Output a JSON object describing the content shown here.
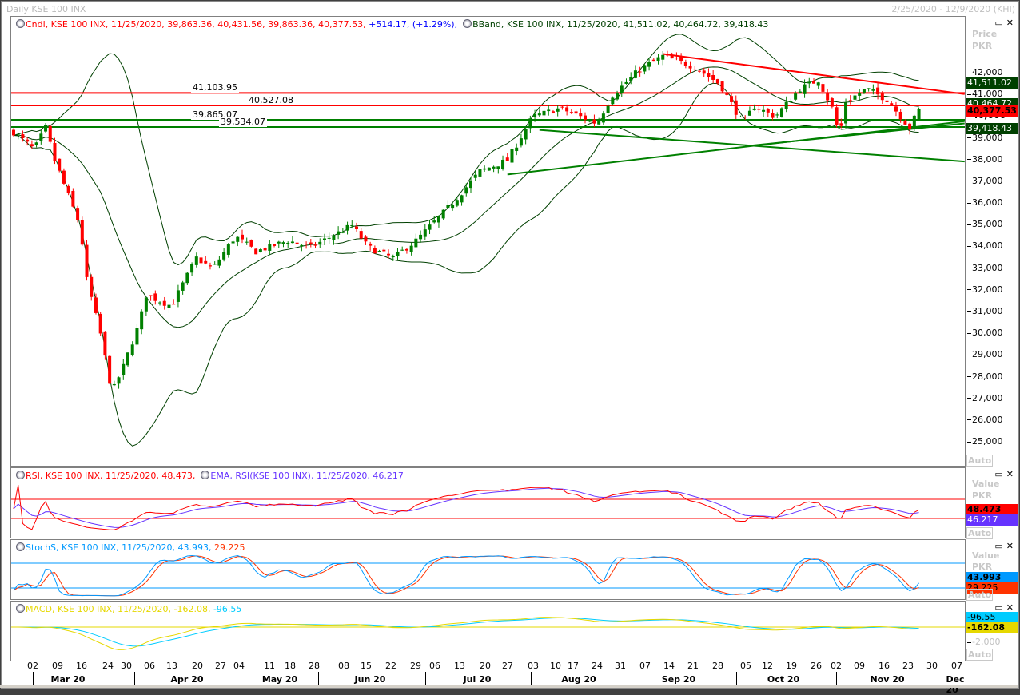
{
  "window": {
    "title": "Daily KSE 100 INX",
    "range": "2/25/2020 - 12/9/2020 (KHI)"
  },
  "price_panel": {
    "header_cndl": "Cndl, KSE 100 INX, 11/25/2020, 39,863.36, 40,431.56, 39,863.36, 40,377.53,",
    "header_change": "+514.17, (+1.29%),",
    "header_bband": "BBand, KSE 100 INX, 11/25/2020, 41,511.02, 40,464.72, 39,418.43",
    "axis_title": "Price",
    "axis_unit": "PKR",
    "auto": "Auto",
    "badges": {
      "bb_upper": "41,511.02",
      "bb_mid": "40,464.72",
      "close": "40,377.53",
      "bb_lower": "39,418.43"
    },
    "hlines": [
      {
        "label": "41,103.95",
        "value": 41103.95,
        "color": "#ff0000"
      },
      {
        "label": "40,527.08",
        "value": 40527.08,
        "color": "#ff0000"
      },
      {
        "label": "39,865.07",
        "value": 39865.07,
        "color": "#008000"
      },
      {
        "label": "39,534.07",
        "value": 39534.07,
        "color": "#008000"
      }
    ],
    "ticks": [
      "42,000",
      "41,000",
      "40,000",
      "39,000",
      "38,000",
      "37,000",
      "36,000",
      "35,000",
      "34,000",
      "33,000",
      "32,000",
      "31,000",
      "30,000",
      "29,000",
      "28,000",
      "27,000",
      "26,000",
      "25,000"
    ]
  },
  "rsi_panel": {
    "header_rsi": "RSI, KSE 100 INX, 11/25/2020, 48.473,",
    "header_ema": "EMA, RSI(KSE 100 INX), 11/25/2020, 46.217",
    "axis_title": "Value",
    "axis_unit": "PKR",
    "rsi_badge": "48.473",
    "ema_badge": "46.217",
    "auto": "Auto"
  },
  "stoch_panel": {
    "header_k": "StochS, KSE 100 INX, 11/25/2020, 43.993,",
    "header_d": "29.225",
    "axis_title": "Value",
    "axis_unit": "PKR",
    "k_badge": "43.993",
    "d_badge": "29.225",
    "auto": "Auto"
  },
  "macd_panel": {
    "header_macd": "MACD, KSE 100 INX, 11/25/2020, -162.08,",
    "header_signal": "-96.55",
    "signal_badge": "-96.55",
    "macd_badge": "-162.08",
    "tick": "-2,000",
    "auto": "Auto"
  },
  "x_axis": {
    "days": [
      "02",
      "09",
      "16",
      "24",
      "30",
      "06",
      "13",
      "20",
      "27",
      "04",
      "11",
      "18",
      "28",
      "08",
      "15",
      "22",
      "29",
      "06",
      "13",
      "20",
      "27",
      "03",
      "10",
      "17",
      "24",
      "31",
      "07",
      "14",
      "21",
      "28",
      "05",
      "12",
      "19",
      "26",
      "02",
      "09",
      "16",
      "23",
      "30",
      "07"
    ],
    "months": [
      "Mar 20",
      "Apr 20",
      "May 20",
      "Jun 20",
      "Jul 20",
      "Aug 20",
      "Sep 20",
      "Oct 20",
      "Nov 20",
      "Dec 20"
    ]
  },
  "colors": {
    "up": "#008000",
    "down": "#ff0000",
    "bband": "#004000",
    "rsi": "#ff0000",
    "ema": "#6633ff",
    "stoch_k": "#0099ff",
    "stoch_d": "#ff3300",
    "macd": "#e6d800",
    "signal": "#00ccff"
  },
  "chart_data": {
    "type": "candlestick",
    "title": "Daily KSE 100 INX",
    "ylabel": "Price PKR",
    "ylim": [
      24500,
      43500
    ],
    "last_bar": {
      "date": "11/25/2020",
      "open": 39863.36,
      "high": 40431.56,
      "low": 39863.36,
      "close": 40377.53
    },
    "close_keypoints_bar_price": [
      [
        0,
        39300
      ],
      [
        4.5,
        38500
      ],
      [
        7,
        39500
      ],
      [
        9,
        38000
      ],
      [
        14.5,
        35000
      ],
      [
        16,
        32500
      ],
      [
        19,
        30000
      ],
      [
        21.5,
        27300
      ],
      [
        24,
        28500
      ],
      [
        27.5,
        30500
      ],
      [
        29,
        31800
      ],
      [
        34.5,
        31300
      ],
      [
        40,
        33500
      ],
      [
        43.5,
        33000
      ],
      [
        48.5,
        34500
      ],
      [
        53,
        33800
      ],
      [
        60,
        34300
      ],
      [
        65,
        34000
      ],
      [
        74,
        35000
      ],
      [
        77.5,
        34000
      ],
      [
        83,
        33500
      ],
      [
        88,
        34300
      ],
      [
        95,
        35800
      ],
      [
        102,
        37500
      ],
      [
        108,
        38000
      ],
      [
        113.5,
        40000
      ],
      [
        119.5,
        40400
      ],
      [
        127.5,
        39700
      ],
      [
        131,
        41000
      ],
      [
        137,
        42200
      ],
      [
        142,
        42800
      ],
      [
        149,
        42300
      ],
      [
        154.5,
        41500
      ],
      [
        159.5,
        39700
      ],
      [
        162,
        40500
      ],
      [
        166.5,
        40000
      ],
      [
        172,
        41300
      ],
      [
        176,
        41700
      ],
      [
        179.5,
        40200
      ],
      [
        180.5,
        39000
      ],
      [
        182,
        40700
      ],
      [
        186.5,
        41300
      ],
      [
        191,
        40800
      ],
      [
        196,
        39500
      ],
      [
        198,
        40377.53
      ]
    ],
    "trendlines": [
      {
        "color": "#ff0000",
        "from": [
          142,
          42900
        ],
        "to": [
          208,
          41050
        ]
      },
      {
        "color": "#008000",
        "from": [
          108,
          37350
        ],
        "to": [
          208,
          39800
        ]
      },
      {
        "color": "#008000",
        "from": [
          115,
          39400
        ],
        "to": [
          208,
          37950
        ]
      },
      {
        "color": "#008000",
        "from": [
          160,
          38650
        ],
        "to": [
          208,
          39700
        ]
      }
    ],
    "indicators": {
      "bband": {
        "period": 20,
        "std": 2
      },
      "rsi": {
        "period": 14,
        "ema": 9,
        "levels": [
          30,
          70
        ]
      },
      "stoch": {
        "k": 14,
        "slow": 3,
        "d": 3,
        "levels": [
          20,
          80
        ]
      },
      "macd": {
        "fast": 12,
        "slow": 26,
        "signal": 9
      }
    }
  }
}
